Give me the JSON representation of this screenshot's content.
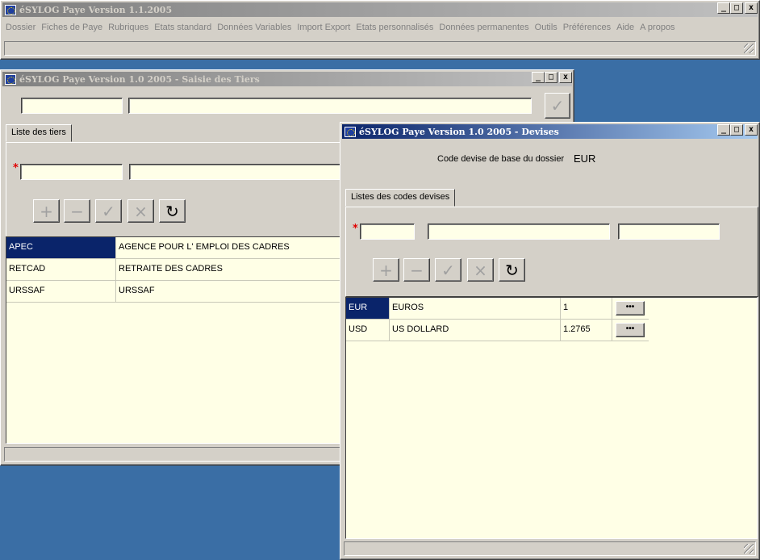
{
  "main_window": {
    "title": "éSYLOG Paye Version 1.1.2005",
    "menu": [
      "Dossier",
      "Fiches de Paye",
      "Rubriques",
      "Etats standard",
      "Données Variables",
      "Import Export",
      "Etats personnalisés",
      "Données permanentes",
      "Outils",
      "Préférences",
      "Aide",
      "A propos"
    ]
  },
  "caption_buttons": {
    "minimize": "_",
    "maximize": "□",
    "close": "x"
  },
  "tiers_window": {
    "title": "éSYLOG Paye Version 1.0 2005  -  Saisie des Tiers",
    "tab": "Liste des tiers",
    "required_marker": "*",
    "rows": [
      {
        "code": "APEC",
        "name": "AGENCE POUR L' EMPLOI DES CADRES"
      },
      {
        "code": "RETCAD",
        "name": "RETRAITE DES CADRES"
      },
      {
        "code": "URSSAF",
        "name": "URSSAF"
      }
    ]
  },
  "devises_window": {
    "title": "éSYLOG Paye Version 1.0 2005  -  Devises",
    "base_label": "Code devise de base du dossier",
    "base_value": "EUR",
    "tab": "Listes des codes devises",
    "required_marker": "*",
    "rows": [
      {
        "code": "EUR",
        "name": "EUROS",
        "rate": "1",
        "button": "•••"
      },
      {
        "code": "USD",
        "name": "US DOLLARD",
        "rate": "1.2765",
        "button": "•••"
      }
    ]
  },
  "toolbar_icons": {
    "add": "+",
    "remove": "−",
    "validate": "✓",
    "cancel": "×",
    "refresh": "↻"
  }
}
